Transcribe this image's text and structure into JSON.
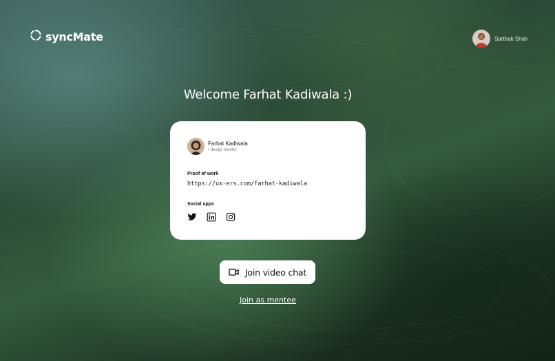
{
  "brand": {
    "name": "syncMate",
    "logo_icon": "sync-icon"
  },
  "user": {
    "name": "Sarthak Shah",
    "avatar_icon": "avatar"
  },
  "welcome": {
    "text": "Welcome Farhat Kadiwala :)"
  },
  "card": {
    "profile": {
      "name": "Farhat Kadiwala",
      "role": "design mentor"
    },
    "proof_of_work": {
      "title": "Proof of work",
      "link": "https://ux-ers.com/farhat-kadiwala"
    },
    "social": {
      "title": "Social apps",
      "icons": [
        "twitter-icon",
        "linkedin-icon",
        "instagram-icon"
      ]
    }
  },
  "actions": {
    "join_video_label": "Join video chat",
    "join_mentee_label": "Join as mentee"
  },
  "colors": {
    "background_dark": "#1d3122",
    "background_mid": "#345a3e",
    "card": "#ffffff"
  }
}
